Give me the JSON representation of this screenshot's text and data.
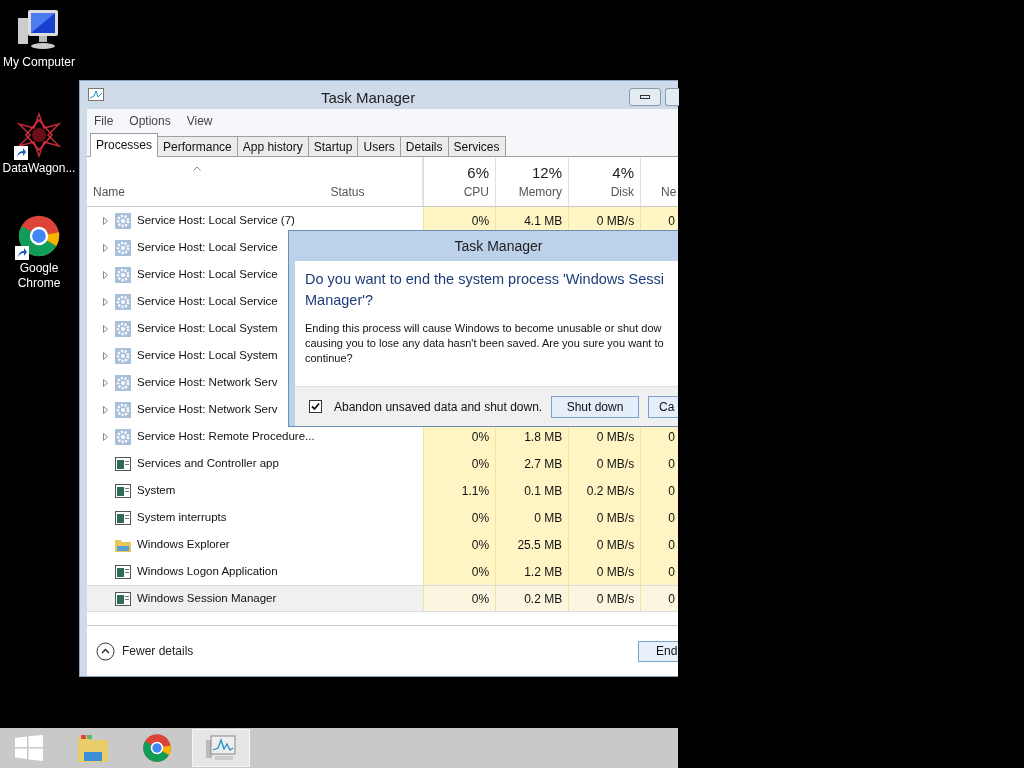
{
  "desktop_icons": [
    {
      "label": "My Computer",
      "kind": "computer",
      "shortcut": false
    },
    {
      "label": "DataWagon...",
      "kind": "star",
      "shortcut": true
    },
    {
      "label": "Google Chrome",
      "kind": "chrome",
      "shortcut": true
    }
  ],
  "window": {
    "title": "Task Manager",
    "menu": [
      "File",
      "Options",
      "View"
    ],
    "tabs": [
      {
        "label": "Processes",
        "selected": true
      },
      {
        "label": "Performance",
        "selected": false
      },
      {
        "label": "App history",
        "selected": false
      },
      {
        "label": "Startup",
        "selected": false
      },
      {
        "label": "Users",
        "selected": false
      },
      {
        "label": "Details",
        "selected": false
      },
      {
        "label": "Services",
        "selected": false
      }
    ],
    "columns": [
      {
        "kind": "name",
        "label": "Name",
        "sorted": true
      },
      {
        "kind": "status",
        "label": "Status",
        "sorted": false
      },
      {
        "kind": "metric",
        "percent": "6%",
        "label": "CPU",
        "sorted": false
      },
      {
        "kind": "metric",
        "percent": "12%",
        "label": "Memory",
        "sorted": false
      },
      {
        "kind": "metric",
        "percent": "4%",
        "label": "Disk",
        "sorted": false
      },
      {
        "kind": "metric",
        "label": "Ne",
        "sorted": false
      }
    ],
    "rows": [
      {
        "name": "Service Host: Local Service (7)",
        "kind": "gear",
        "expandable": true,
        "selected": false,
        "cells": [
          "0%",
          "4.1 MB",
          "0 MB/s",
          "0"
        ]
      },
      {
        "name": "Service Host: Local Service",
        "kind": "gear",
        "expandable": true,
        "selected": false
      },
      {
        "name": "Service Host: Local Service",
        "kind": "gear",
        "expandable": true,
        "selected": false
      },
      {
        "name": "Service Host: Local Service",
        "kind": "gear",
        "expandable": true,
        "selected": false
      },
      {
        "name": "Service Host: Local System",
        "kind": "gear",
        "expandable": true,
        "selected": false
      },
      {
        "name": "Service Host: Local System",
        "kind": "gear",
        "expandable": true,
        "selected": false
      },
      {
        "name": "Service Host: Network Serv",
        "kind": "gear",
        "expandable": true,
        "selected": false
      },
      {
        "name": "Service Host: Network Serv",
        "kind": "gear",
        "expandable": true,
        "selected": false
      },
      {
        "name": "Service Host: Remote Procedure...",
        "kind": "gear",
        "expandable": true,
        "selected": false,
        "cells": [
          "0%",
          "1.8 MB",
          "0 MB/s",
          "0"
        ]
      },
      {
        "name": "Services and Controller app",
        "kind": "app",
        "expandable": false,
        "selected": false,
        "cells": [
          "0%",
          "2.7 MB",
          "0 MB/s",
          "0"
        ]
      },
      {
        "name": "System",
        "kind": "app",
        "expandable": false,
        "selected": false,
        "cells": [
          "1.1%",
          "0.1 MB",
          "0.2 MB/s",
          "0"
        ]
      },
      {
        "name": "System interrupts",
        "kind": "app",
        "expandable": false,
        "selected": false,
        "cells": [
          "0%",
          "0 MB",
          "0 MB/s",
          "0"
        ]
      },
      {
        "name": "Windows Explorer",
        "kind": "folder",
        "expandable": false,
        "selected": false,
        "cells": [
          "0%",
          "25.5 MB",
          "0 MB/s",
          "0"
        ]
      },
      {
        "name": "Windows Logon Application",
        "kind": "app",
        "expandable": false,
        "selected": false,
        "cells": [
          "0%",
          "1.2 MB",
          "0 MB/s",
          "0"
        ]
      },
      {
        "name": "Windows Session Manager",
        "kind": "app",
        "expandable": false,
        "selected": true,
        "cells": [
          "0%",
          "0.2 MB",
          "0 MB/s",
          "0"
        ]
      }
    ],
    "toggle": "Fewer details",
    "end_button": "End"
  },
  "dialog": {
    "title": "Task Manager",
    "heading_lines": [
      "Do you want to end the system process 'Windows Sessi",
      "Manager'?"
    ],
    "body_lines": [
      "Ending this process will cause Windows to become unusable or shut dow",
      "causing you to lose any data hasn't been saved. Are you sure you want to",
      "continue?"
    ],
    "checkbox": {
      "label": "Abandon unsaved data and shut down.",
      "checked": true
    },
    "buttons": [
      "Shut down",
      "Ca"
    ]
  },
  "taskbar": [
    {
      "kind": "start",
      "selected": false
    },
    {
      "kind": "explorer",
      "selected": false
    },
    {
      "kind": "chrome",
      "selected": false
    },
    {
      "kind": "taskmanager",
      "selected": true
    }
  ]
}
